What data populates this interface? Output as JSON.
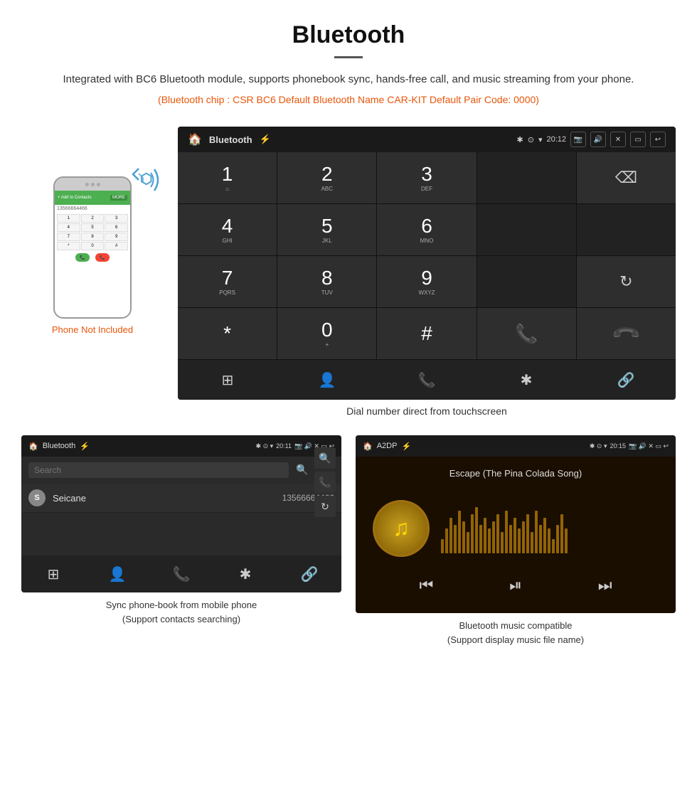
{
  "page": {
    "title": "Bluetooth",
    "title_divider": true,
    "description": "Integrated with BC6 Bluetooth module, supports phonebook sync, hands-free call, and music streaming from your phone.",
    "specs": "(Bluetooth chip : CSR BC6    Default Bluetooth Name CAR-KIT    Default Pair Code: 0000)",
    "dial_caption": "Dial number direct from touchscreen",
    "phone_not_included": "Phone Not Included",
    "bottom_left_caption": "Sync phone-book from mobile phone\n(Support contacts searching)",
    "bottom_right_caption": "Bluetooth music compatible\n(Support display music file name)"
  },
  "car_screen": {
    "status_bar": {
      "left_icon": "🏠",
      "title": "Bluetooth",
      "usb_icon": "⚡",
      "bluetooth_icon": "✱",
      "location_icon": "⊙",
      "wifi_icon": "▾",
      "time": "20:12",
      "camera_icon": "📷",
      "volume_icon": "🔊",
      "x_icon": "✕",
      "window_icon": "▭",
      "back_icon": "↩"
    },
    "dialpad": {
      "rows": [
        [
          {
            "main": "1",
            "sub": "⌂"
          },
          {
            "main": "2",
            "sub": "ABC"
          },
          {
            "main": "3",
            "sub": "DEF"
          },
          {
            "main": "",
            "sub": ""
          },
          {
            "main": "⌫",
            "sub": ""
          }
        ],
        [
          {
            "main": "4",
            "sub": "GHI"
          },
          {
            "main": "5",
            "sub": "JKL"
          },
          {
            "main": "6",
            "sub": "MNO"
          },
          {
            "main": "",
            "sub": ""
          },
          {
            "main": "",
            "sub": ""
          }
        ],
        [
          {
            "main": "7",
            "sub": "PQRS"
          },
          {
            "main": "8",
            "sub": "TUV"
          },
          {
            "main": "9",
            "sub": "WXYZ"
          },
          {
            "main": "",
            "sub": ""
          },
          {
            "main": "↻",
            "sub": ""
          }
        ],
        [
          {
            "main": "*",
            "sub": ""
          },
          {
            "main": "0",
            "sub": "+"
          },
          {
            "main": "#",
            "sub": ""
          },
          {
            "main": "📞",
            "sub": ""
          },
          {
            "main": "📞",
            "sub": "end"
          }
        ]
      ],
      "nav_items": [
        "⊞",
        "👤",
        "📞",
        "✱",
        "🔗"
      ]
    }
  },
  "phonebook_screen": {
    "status": {
      "left": "Bluetooth  ⚡",
      "right": "✱ ⊙ ▾ 20:11 📷 🔊 ✕ ▭ ↩"
    },
    "search_placeholder": "Search",
    "contacts": [
      {
        "letter": "S",
        "name": "Seicane",
        "number": "13566664466"
      }
    ],
    "nav_items": [
      "⊞",
      "👤",
      "📞",
      "✱",
      "🔗"
    ]
  },
  "music_screen": {
    "status": {
      "left": "A2DP  ⚡",
      "right": "✱ ⊙ ▾ 20:15 📷 🔊 ✕ ▭ ↩"
    },
    "song_title": "Escape (The Pina Colada Song)",
    "album_art_icon": "♫",
    "controls": [
      "⏮",
      "⏯",
      "⏭"
    ],
    "visualizer_bars": [
      20,
      35,
      50,
      40,
      60,
      45,
      30,
      55,
      65,
      40,
      50,
      35,
      45,
      55,
      30,
      60,
      40,
      50,
      35,
      45,
      55,
      30,
      60,
      40,
      50,
      35,
      20,
      40,
      55,
      35
    ]
  }
}
